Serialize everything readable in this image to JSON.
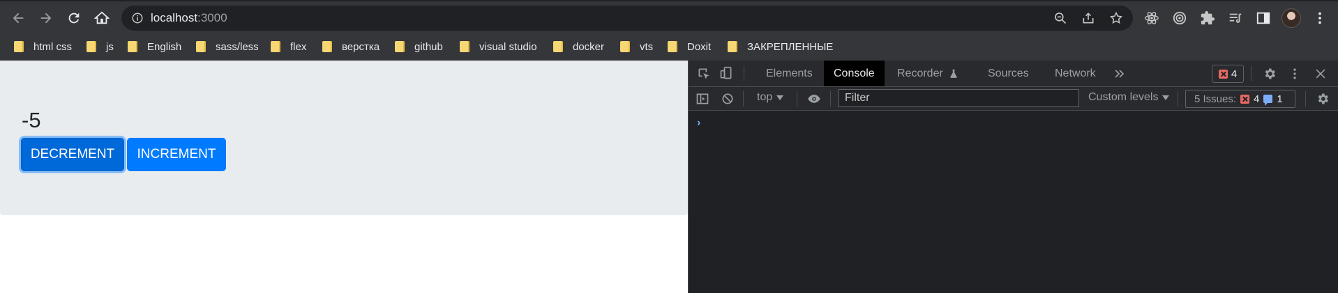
{
  "browser": {
    "url_host": "localhost",
    "url_port": ":3000",
    "bookmarks": [
      {
        "label": "html css"
      },
      {
        "label": "js"
      },
      {
        "label": "English"
      },
      {
        "label": "sass/less"
      },
      {
        "label": "flex"
      },
      {
        "label": "верстка"
      },
      {
        "label": "github"
      },
      {
        "label": "visual studio"
      },
      {
        "label": "docker"
      },
      {
        "label": "vts"
      },
      {
        "label": "Doxit"
      },
      {
        "label": "ЗАКРЕПЛЕННЫЕ"
      }
    ],
    "icons": [
      "back-icon",
      "forward-icon",
      "reload-icon",
      "home-icon",
      "info-icon",
      "zoom-icon",
      "share-icon",
      "bookmark-star-icon",
      "react-devtools-icon",
      "target-icon",
      "extensions-icon",
      "reading-list-icon",
      "side-panel-icon",
      "menu-icon"
    ]
  },
  "page": {
    "counter": "-5",
    "decrement_label": "DECREMENT",
    "increment_label": "INCREMENT"
  },
  "devtools": {
    "tabs": [
      {
        "label": "Elements"
      },
      {
        "label": "Console"
      },
      {
        "label": "Recorder"
      },
      {
        "label": "Sources"
      },
      {
        "label": "Network"
      }
    ],
    "active_tab": "Console",
    "error_count": "4",
    "context": "top",
    "filter_placeholder": "Filter",
    "levels": "Custom levels",
    "issues_label": "5 Issues:",
    "issues_errors": "4",
    "issues_info": "1",
    "prompt": "›"
  },
  "colors": {
    "primary_button": "#007bff",
    "jumbotron_bg": "#e9ecef",
    "devtools_bg": "#202124",
    "error_red": "#e46962",
    "info_blue": "#7cacf8"
  }
}
